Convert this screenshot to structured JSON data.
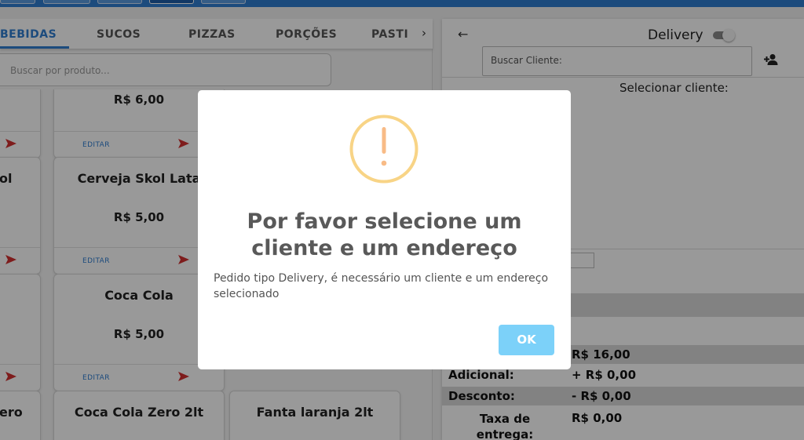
{
  "tabs": {
    "items": [
      {
        "label": "BEBIDAS",
        "active": true
      },
      {
        "label": "SUCOS",
        "active": false
      },
      {
        "label": "PIZZAS",
        "active": false
      },
      {
        "label": "PORÇÕES",
        "active": false
      },
      {
        "label": "PASTI",
        "active": false
      }
    ],
    "next_icon": "chevron-right-icon"
  },
  "product_search": {
    "placeholder": "Buscar por produto..."
  },
  "products": [
    {
      "name": "",
      "price": "R$ 6,00",
      "edit_label": "EDITAR"
    },
    {
      "name": "ol",
      "price": "",
      "edit_label": ""
    },
    {
      "name": "Cerveja Skol Lata",
      "price": "R$ 5,00",
      "edit_label": "EDITAR"
    },
    {
      "name": "",
      "price": "",
      "edit_label": ""
    },
    {
      "name": "Coca Cola",
      "price": "R$ 5,00",
      "edit_label": "EDITAR"
    },
    {
      "name": "ero",
      "price": "",
      "edit_label": ""
    },
    {
      "name": "Coca Cola Zero 2lt",
      "price": "",
      "edit_label": ""
    },
    {
      "name": "Fanta laranja 2lt",
      "price": "",
      "edit_label": ""
    }
  ],
  "order_panel": {
    "back_icon": "arrow-left-icon",
    "delivery_label": "Delivery",
    "delivery_enabled": false,
    "client_search_placeholder": "Buscar Cliente:",
    "add_client_icon": "add-user-icon",
    "select_client_label": "Selecionar cliente:",
    "totals": [
      {
        "label": "",
        "value": "R$ 16,00"
      },
      {
        "label": "Adicional:",
        "value": "+ R$ 0,00"
      },
      {
        "label": "Desconto:",
        "value": "- R$ 0,00"
      },
      {
        "label": "Taxa de entrega:",
        "value": "R$ 0,00"
      }
    ]
  },
  "modal": {
    "icon": "warning-icon",
    "title": "Por favor selecione um cliente e um endereço",
    "text": "Pedido tipo Delivery, é necessário um cliente e um endereço selecionado",
    "ok_label": "OK"
  },
  "colors": {
    "primary": "#2f7dd1",
    "warning": "#f8bb86",
    "ok_button": "#7cd1f9",
    "send_arrow": "#d32f2f"
  }
}
